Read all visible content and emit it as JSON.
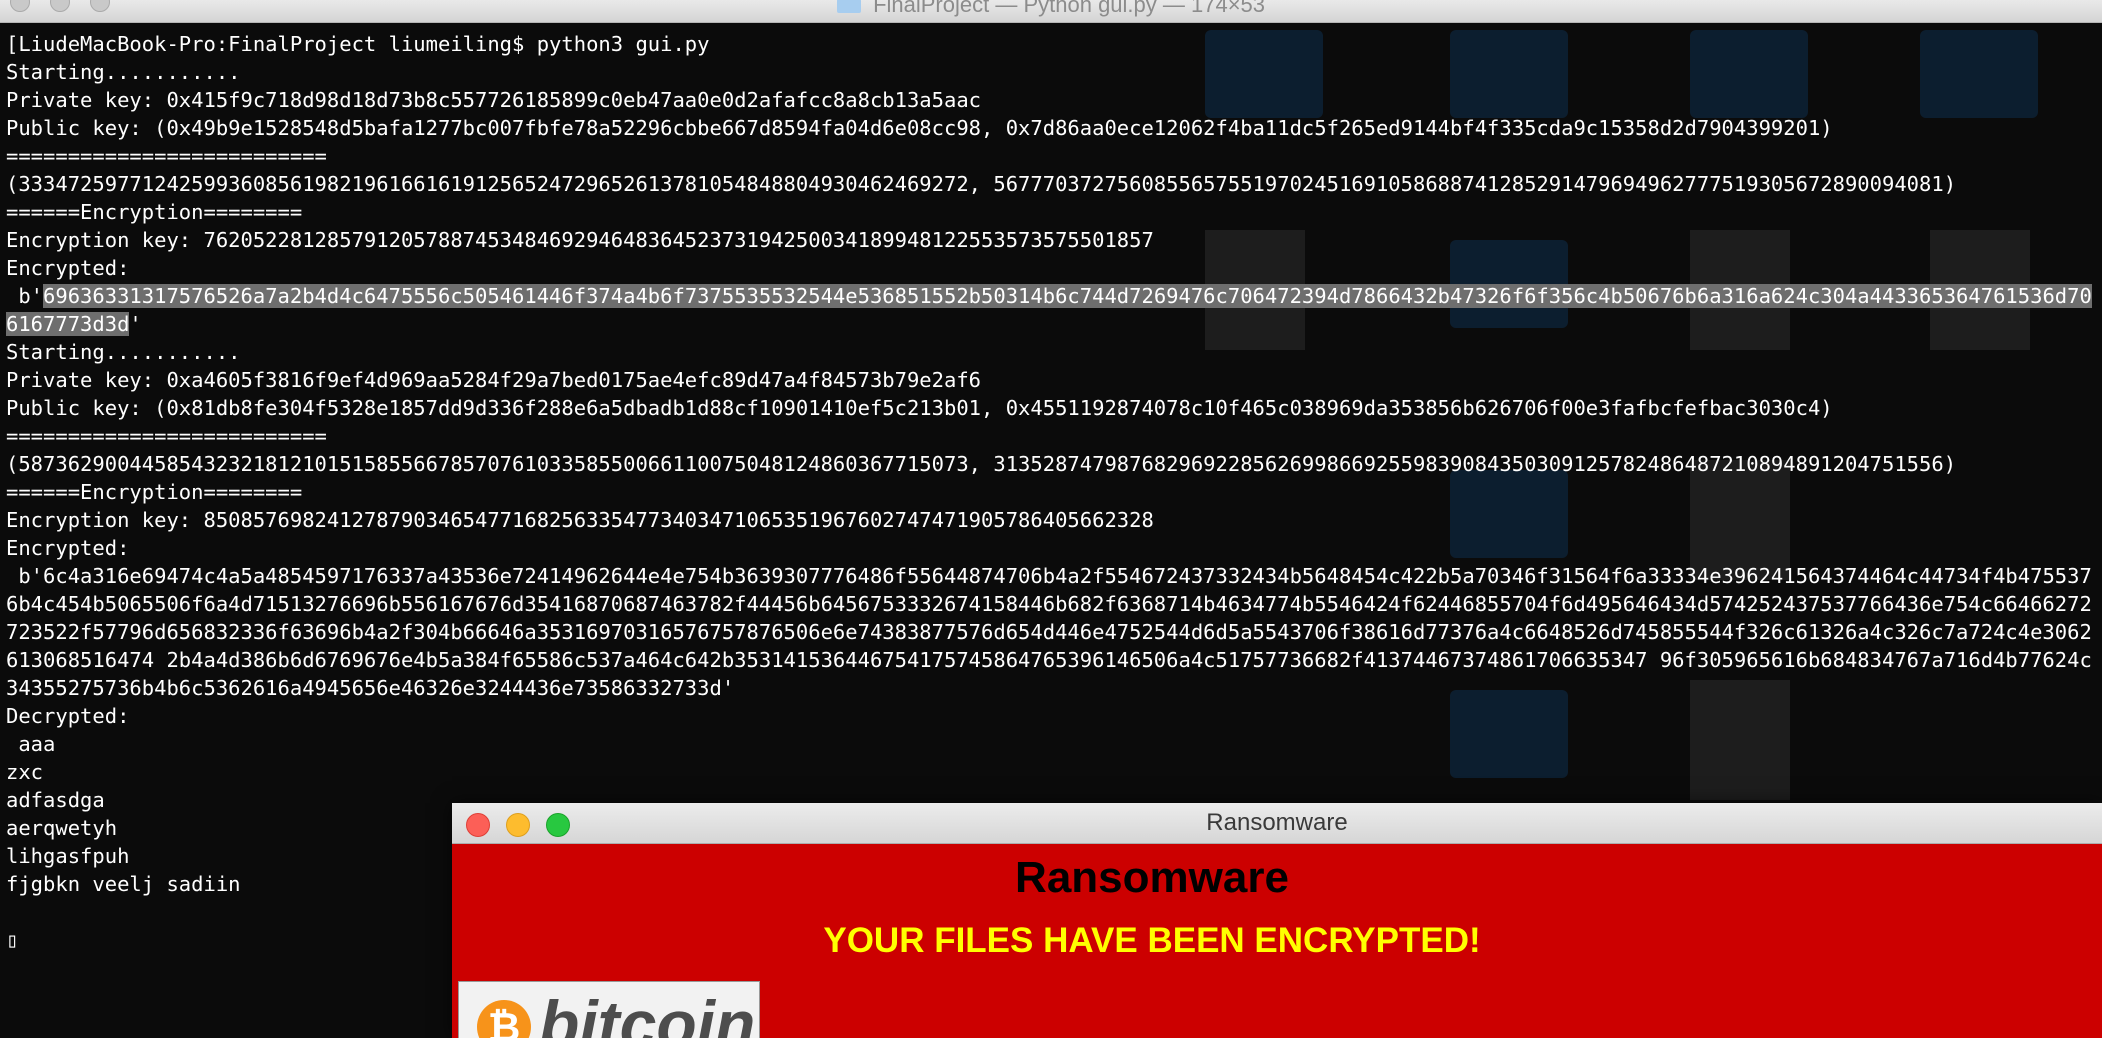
{
  "window_title": "FinalProject — Python gui.py — 174×53",
  "terminal": {
    "lines": [
      {
        "text": "[LiudeMacBook-Pro:FinalProject liumeiling$ python3 gui.py"
      },
      {
        "text": "Starting..........."
      },
      {
        "text": "Private key: 0x415f9c718d98d18d73b8c557726185899c0eb47aa0e0d2afafcc8a8cb13a5aac"
      },
      {
        "text": "Public key: (0x49b9e1528548d5bafa1277bc007fbfe78a52296cbbe667d8594fa04d6e08cc98, 0x7d86aa0ece12062f4ba11dc5f265ed9144bf4f335cda9c15358d2d7904399201)"
      },
      {
        "text": "=========================="
      },
      {
        "text": "(33347259771242599360856198219616616191256524729652613781054848804930462469272, 56777037275608556575519702451691058688741285291479694962777519305672890094081)"
      },
      {
        "text": "======Encryption========"
      },
      {
        "text": "Encryption key: 76205228128579120578874534846929464836452373194250034189948122553573575501857"
      },
      {
        "text": "Encrypted:"
      },
      {
        "text": " b'69636331317576526a7a2b4d4c6475556c505461446f374a4b6f7375535532544e536851552b50314b6c744d7269476c706472394d7866432b47326f6f356c4b50676b6a316a624c304a443365364761536d706167773d3d'",
        "wrap": true,
        "highlight_from": 3
      },
      {
        "text": "Starting..........."
      },
      {
        "text": "Private key: 0xa4605f3816f9ef4d969aa5284f29a7bed0175ae4efc89d47a4f84573b79e2af6"
      },
      {
        "text": "Public key: (0x81db8fe304f5328e1857dd9d336f288e6a5dbadb1d88cf10901410ef5c213b01, 0x4551192874078c10f465c038969da353856b626706f00e3fafbcfefbac3030c4)"
      },
      {
        "text": "=========================="
      },
      {
        "text": "(58736290044585432321812101515855667857076103358550066110075048124860367715073, 31352874798768296922856269986692559839084350309125782486487210894891204751556)"
      },
      {
        "text": "======Encryption========"
      },
      {
        "text": "Encryption key: 85085769824127879034654771682563354773403471065351967602747471905786405662328"
      },
      {
        "text": "Encrypted:"
      },
      {
        "text": " b'6c4a316e69474c4a5a4854597176337a43536e72414962644e4e754b3639307776486f55644874706b4a2f554672437332434b5648454c422b5a70346f31564f6a33334e396241564374464c44734f4b4755376b4c454b5065506f6a4d71513276696b556167676d35416870687463782f44456b6456753332674158446b682f6368714b4634774b5546424f62446855704f6d495646434d574252437537766436e754c66466272723522f57796d656832336f63696b4a2f304b66646a35316970316576757876506e6e74383877576d654d446e4752544d6d5a5543706f38616d77376a4c6648526d745855544f326c61326a4c326c7a724c4e3062613068516474 2b4a4d386b6d6769676e4b5a384f65586c537a464c642b353141536446754175745864765396146506a4c51757736682f41374467374861706635347 96f305965616b684834767a716d4b77624c34355275736b4b6c5362616a4945656e46326e3244436e73586332733d'",
        "wrap": true
      },
      {
        "text": "Decrypted:"
      },
      {
        "text": " aaa"
      },
      {
        "text": "zxc"
      },
      {
        "text": "adfasdga"
      },
      {
        "text": "aerqwetyh"
      },
      {
        "text": "lihgasfpuh"
      },
      {
        "text": "fjgbkn veelj sadiin"
      },
      {
        "text": ""
      },
      {
        "text": "▯"
      }
    ]
  },
  "ransom_window": {
    "title": "Ransomware",
    "heading": "Ransomware",
    "warning": "YOUR FILES HAVE BEEN ENCRYPTED!",
    "logo_text": "bitcoin",
    "logo_symbol": "₿"
  },
  "colors": {
    "terminal_bg": "#0b0b0b",
    "terminal_text": "#ffffff",
    "ransom_bg": "#cc0000",
    "warning_text": "#ffff00"
  }
}
